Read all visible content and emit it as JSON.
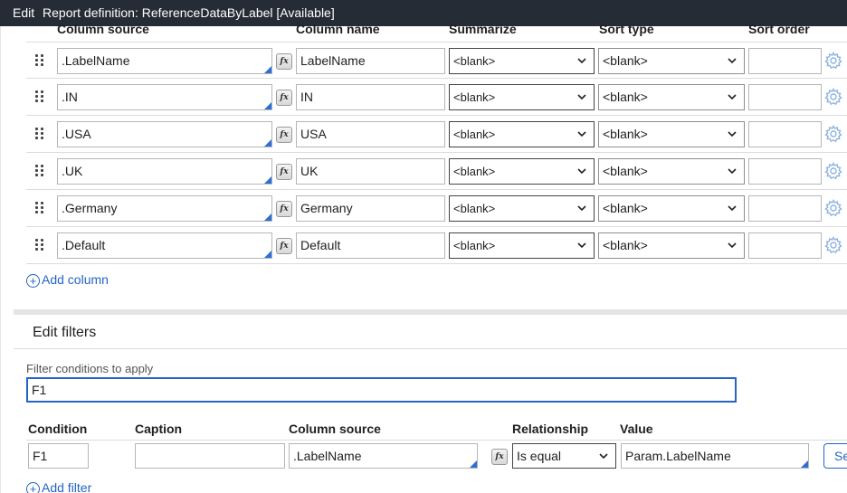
{
  "titlebar": {
    "mode": "Edit",
    "title": "Report definition: ReferenceDataByLabel [Available]"
  },
  "columns_table": {
    "headers": {
      "column_source": "Column source",
      "column_name": "Column name",
      "summarize": "Summarize",
      "sort_type": "Sort type",
      "sort_order": "Sort order"
    },
    "rows": [
      {
        "column_source": ".LabelName",
        "column_name": "LabelName",
        "summarize": "<blank>",
        "sort_type": "<blank>",
        "sort_order": ""
      },
      {
        "column_source": ".IN",
        "column_name": "IN",
        "summarize": "<blank>",
        "sort_type": "<blank>",
        "sort_order": ""
      },
      {
        "column_source": ".USA",
        "column_name": "USA",
        "summarize": "<blank>",
        "sort_type": "<blank>",
        "sort_order": ""
      },
      {
        "column_source": ".UK",
        "column_name": "UK",
        "summarize": "<blank>",
        "sort_type": "<blank>",
        "sort_order": ""
      },
      {
        "column_source": ".Germany",
        "column_name": "Germany",
        "summarize": "<blank>",
        "sort_type": "<blank>",
        "sort_order": ""
      },
      {
        "column_source": ".Default",
        "column_name": "Default",
        "summarize": "<blank>",
        "sort_type": "<blank>",
        "sort_order": ""
      }
    ],
    "fx_label": "fx",
    "add_column_label": "Add column"
  },
  "filters": {
    "section_title": "Edit filters",
    "conditions_label": "Filter conditions to apply",
    "conditions_value": "F1",
    "headers": {
      "condition": "Condition",
      "caption": "Caption",
      "column_source": "Column source",
      "relationship": "Relationship",
      "value": "Value"
    },
    "rows": [
      {
        "condition": "F1",
        "caption": "",
        "column_source": ".LabelName",
        "relationship": "Is equal",
        "value": "Param.LabelName",
        "action_label": "Se"
      }
    ],
    "add_filter_label": "Add filter"
  },
  "icons": {
    "drag": "drag-handle-icon",
    "gear": "gear-icon",
    "chevron": "chevron-down-icon",
    "add": "plus-circle-icon"
  },
  "colors": {
    "titlebar_bg": "#262c36",
    "link_blue": "#2465c4",
    "corner_blue": "#2e6fd7",
    "gear_blue": "#8fb3de"
  }
}
